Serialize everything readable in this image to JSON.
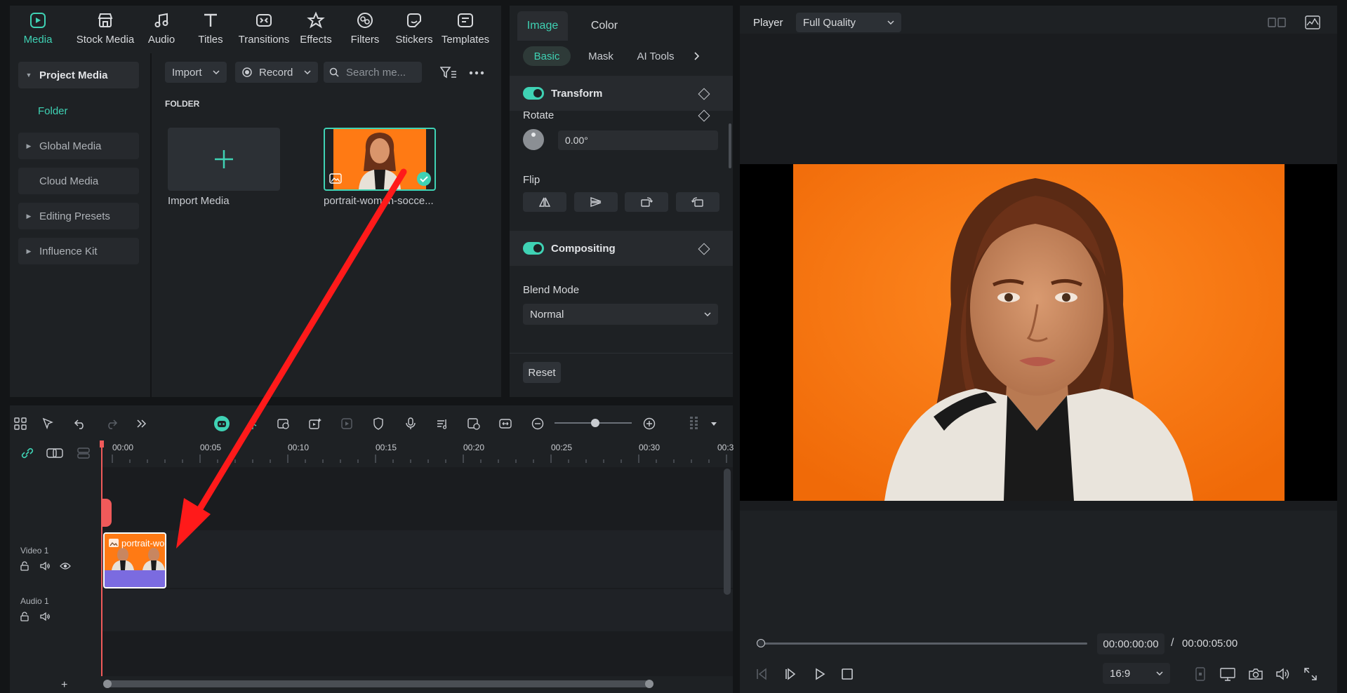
{
  "toolbar": {
    "items": [
      {
        "label": "Media",
        "icon": "media-icon",
        "active": true
      },
      {
        "label": "Stock Media",
        "icon": "stock-media-icon"
      },
      {
        "label": "Audio",
        "icon": "audio-icon"
      },
      {
        "label": "Titles",
        "icon": "titles-icon"
      },
      {
        "label": "Transitions",
        "icon": "transitions-icon"
      },
      {
        "label": "Effects",
        "icon": "effects-icon"
      },
      {
        "label": "Filters",
        "icon": "filters-icon"
      },
      {
        "label": "Stickers",
        "icon": "stickers-icon"
      },
      {
        "label": "Templates",
        "icon": "templates-icon"
      }
    ]
  },
  "sidebar": {
    "project_media": "Project Media",
    "folder": "Folder",
    "global_media": "Global Media",
    "cloud_media": "Cloud Media",
    "editing_presets": "Editing Presets",
    "influence_kit": "Influence Kit"
  },
  "media": {
    "import_label": "Import",
    "record_label": "Record",
    "search_placeholder": "Search me...",
    "folder_heading": "FOLDER",
    "import_media_label": "Import Media",
    "clip_name": "portrait-woman-socce..."
  },
  "properties": {
    "tabs": [
      "Image",
      "Color"
    ],
    "subtabs": [
      "Basic",
      "Mask",
      "AI Tools"
    ],
    "transform_label": "Transform",
    "rotate_label": "Rotate",
    "rotate_value": "0.00°",
    "flip_label": "Flip",
    "compositing_label": "Compositing",
    "blend_mode_label": "Blend Mode",
    "blend_mode_value": "Normal",
    "reset_label": "Reset"
  },
  "timeline": {
    "ruler": [
      "00:00",
      "00:05",
      "00:10",
      "00:15",
      "00:20",
      "00:25",
      "00:30",
      "00:3"
    ],
    "video_track": "Video 1",
    "audio_track": "Audio 1",
    "clip_label": "portrait-wo..."
  },
  "player": {
    "label": "Player",
    "quality": "Full Quality",
    "current_time": "00:00:00:00",
    "separator": "/",
    "total_time": "00:00:05:00",
    "aspect": "16:9"
  },
  "colors": {
    "accent": "#3fd2b4",
    "playhead": "#f05a5a",
    "arrow": "#ff1a1a",
    "photo_bg": "#ff7a14"
  }
}
